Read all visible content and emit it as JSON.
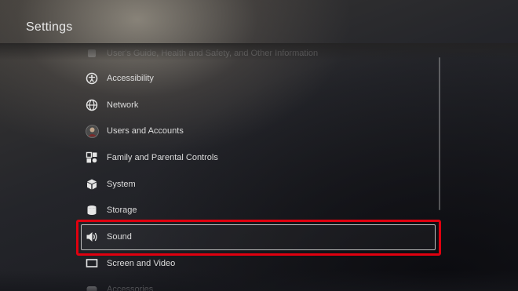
{
  "header": {
    "title": "Settings"
  },
  "menu": {
    "items": [
      {
        "label": "User's Guide, Health and Safety, and Other Information",
        "icon": "info-icon"
      },
      {
        "label": "Accessibility",
        "icon": "accessibility-icon"
      },
      {
        "label": "Network",
        "icon": "globe-icon"
      },
      {
        "label": "Users and Accounts",
        "icon": "avatar-icon"
      },
      {
        "label": "Family and Parental Controls",
        "icon": "family-icon"
      },
      {
        "label": "System",
        "icon": "cube-icon"
      },
      {
        "label": "Storage",
        "icon": "storage-icon"
      },
      {
        "label": "Sound",
        "icon": "speaker-icon"
      },
      {
        "label": "Screen and Video",
        "icon": "monitor-icon"
      },
      {
        "label": "Accessories",
        "icon": "controller-icon"
      }
    ],
    "selected": "Sound"
  },
  "colors": {
    "highlight": "#e0000f",
    "text": "#dcdcdc"
  }
}
